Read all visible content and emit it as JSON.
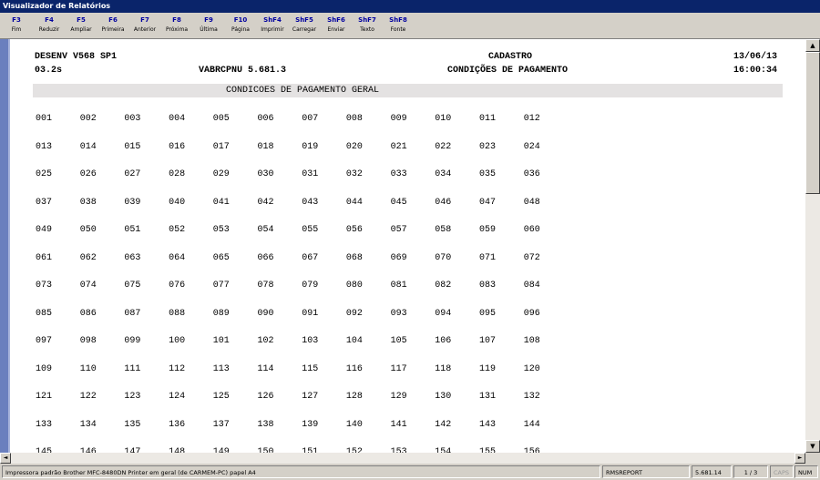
{
  "window": {
    "title": "Visualizador de Relatórios"
  },
  "toolbar": {
    "buttons": [
      {
        "key": "F3",
        "label": "Fim"
      },
      {
        "key": "F4",
        "label": "Reduzir"
      },
      {
        "key": "F5",
        "label": "Ampliar"
      },
      {
        "key": "F6",
        "label": "Primeira"
      },
      {
        "key": "F7",
        "label": "Anterior"
      },
      {
        "key": "F8",
        "label": "Próxima"
      },
      {
        "key": "F9",
        "label": "Última"
      },
      {
        "key": "F10",
        "label": "Página"
      },
      {
        "key": "ShF4",
        "label": "Imprimir"
      },
      {
        "key": "ShF5",
        "label": "Carregar"
      },
      {
        "key": "ShF6",
        "label": "Enviar"
      },
      {
        "key": "ShF7",
        "label": "Texto"
      },
      {
        "key": "ShF8",
        "label": "Fonte"
      }
    ]
  },
  "report": {
    "system": "DESENV V568 SP1",
    "section": "CADASTRO",
    "date": "13/06/13",
    "elapsed": "03.2s",
    "program": "VABRCPNU 5.681.3",
    "subtitle": "CONDIÇÕES DE PAGAMENTO",
    "time": "16:00:34",
    "band_title": "CONDICOES DE PAGAMENTO GERAL",
    "rows": [
      [
        "001",
        "002",
        "003",
        "004",
        "005",
        "006",
        "007",
        "008",
        "009",
        "010",
        "011",
        "012"
      ],
      [
        "013",
        "014",
        "015",
        "016",
        "017",
        "018",
        "019",
        "020",
        "021",
        "022",
        "023",
        "024"
      ],
      [
        "025",
        "026",
        "027",
        "028",
        "029",
        "030",
        "031",
        "032",
        "033",
        "034",
        "035",
        "036"
      ],
      [
        "037",
        "038",
        "039",
        "040",
        "041",
        "042",
        "043",
        "044",
        "045",
        "046",
        "047",
        "048"
      ],
      [
        "049",
        "050",
        "051",
        "052",
        "053",
        "054",
        "055",
        "056",
        "057",
        "058",
        "059",
        "060"
      ],
      [
        "061",
        "062",
        "063",
        "064",
        "065",
        "066",
        "067",
        "068",
        "069",
        "070",
        "071",
        "072"
      ],
      [
        "073",
        "074",
        "075",
        "076",
        "077",
        "078",
        "079",
        "080",
        "081",
        "082",
        "083",
        "084"
      ],
      [
        "085",
        "086",
        "087",
        "088",
        "089",
        "090",
        "091",
        "092",
        "093",
        "094",
        "095",
        "096"
      ],
      [
        "097",
        "098",
        "099",
        "100",
        "101",
        "102",
        "103",
        "104",
        "105",
        "106",
        "107",
        "108"
      ],
      [
        "109",
        "110",
        "111",
        "112",
        "113",
        "114",
        "115",
        "116",
        "117",
        "118",
        "119",
        "120"
      ],
      [
        "121",
        "122",
        "123",
        "124",
        "125",
        "126",
        "127",
        "128",
        "129",
        "130",
        "131",
        "132"
      ],
      [
        "133",
        "134",
        "135",
        "136",
        "137",
        "138",
        "139",
        "140",
        "141",
        "142",
        "143",
        "144"
      ],
      [
        "145",
        "146",
        "147",
        "148",
        "149",
        "150",
        "151",
        "152",
        "153",
        "154",
        "155",
        "156"
      ]
    ]
  },
  "statusbar": {
    "printer": "Impressora padrão Brother MFC-8480DN Printer em geral (de CARMEM-PC) papel A4",
    "app": "RMSREPORT",
    "version": "5.681.14",
    "page": "1 / 3",
    "caps": "CAPS",
    "num": "NUM"
  },
  "scrollbar": {
    "up_glyph": "▲",
    "down_glyph": "▼",
    "left_glyph": "◄",
    "right_glyph": "►"
  }
}
